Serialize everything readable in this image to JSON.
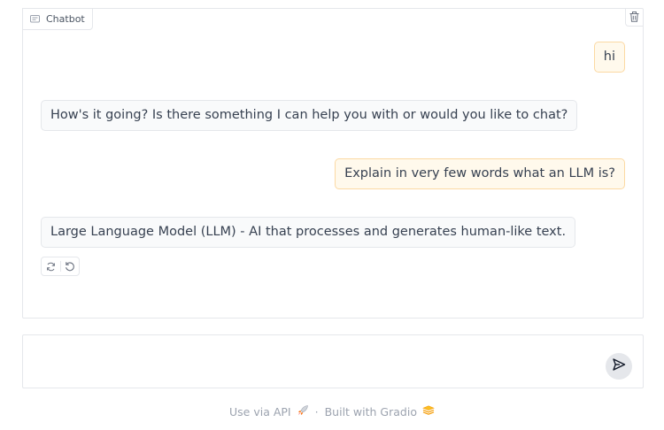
{
  "chatbot": {
    "label": "Chatbot",
    "messages": [
      {
        "role": "user",
        "text": "hi"
      },
      {
        "role": "bot",
        "text": "How's it going? Is there something I can help you with or would you like to chat?"
      },
      {
        "role": "user",
        "text": "Explain in very few words what an LLM is?"
      },
      {
        "role": "bot",
        "text": "Large Language Model (LLM) - AI that processes and generates human-like text."
      }
    ],
    "actions": {
      "retry_icon": "retry-icon",
      "undo_icon": "undo-icon"
    },
    "clear_icon": "trash-icon"
  },
  "input": {
    "value": "",
    "placeholder": "",
    "send_icon": "send-icon"
  },
  "footer": {
    "api_link": "Use via API",
    "separator": "·",
    "built_with": "Built with Gradio"
  },
  "colors": {
    "user_bubble_bg": "#fff9ec",
    "user_bubble_border": "#fbd9a3",
    "bot_bubble_bg": "#f9fafb",
    "border": "#e5e7eb",
    "gradio_orange": "#f59e0b"
  }
}
